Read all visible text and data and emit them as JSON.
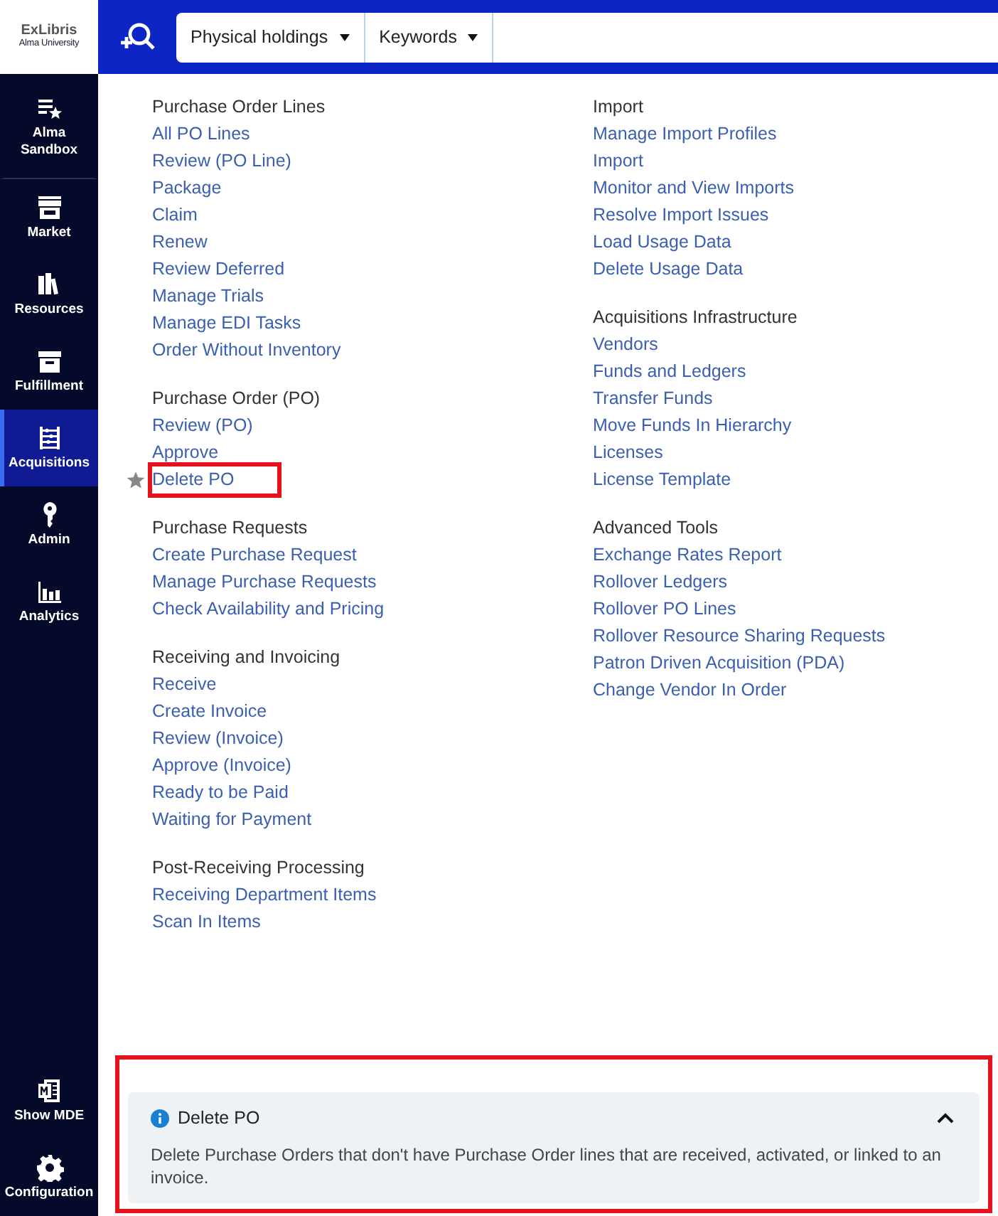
{
  "logo": {
    "brand": "ExLibris",
    "institution": "Alma University"
  },
  "search": {
    "scope": "Physical holdings",
    "field": "Keywords"
  },
  "sidebar": {
    "items": [
      {
        "label": "Alma Sandbox",
        "kind": "favorites",
        "selected": false
      },
      {
        "label": "Market",
        "kind": "market",
        "selected": false
      },
      {
        "label": "Resources",
        "kind": "resources",
        "selected": false
      },
      {
        "label": "Fulfillment",
        "kind": "fulfillment",
        "selected": false
      },
      {
        "label": "Acquisitions",
        "kind": "acquisitions",
        "selected": true
      },
      {
        "label": "Admin",
        "kind": "admin",
        "selected": false
      },
      {
        "label": "Analytics",
        "kind": "analytics",
        "selected": false
      }
    ],
    "bottom_items": [
      {
        "label": "Show MDE",
        "kind": "editor",
        "selected": false
      },
      {
        "label": "Configuration",
        "kind": "configuration",
        "selected": false
      }
    ]
  },
  "menu": {
    "columns": [
      {
        "sections": [
          {
            "heading": "Purchase Order Lines",
            "links": [
              {
                "label": "All PO Lines",
                "highlighted": false
              },
              {
                "label": "Review (PO Line)",
                "highlighted": false
              },
              {
                "label": "Package",
                "highlighted": false
              },
              {
                "label": "Claim",
                "highlighted": false
              },
              {
                "label": "Renew",
                "highlighted": false
              },
              {
                "label": "Review Deferred",
                "highlighted": false
              },
              {
                "label": "Manage Trials",
                "highlighted": false
              },
              {
                "label": "Manage EDI Tasks",
                "highlighted": false
              },
              {
                "label": "Order Without Inventory",
                "highlighted": false
              }
            ]
          },
          {
            "heading": "Purchase Order (PO)",
            "links": [
              {
                "label": "Review (PO)",
                "highlighted": false
              },
              {
                "label": "Approve",
                "highlighted": false
              },
              {
                "label": "Delete PO",
                "highlighted": true
              }
            ]
          },
          {
            "heading": "Purchase Requests",
            "links": [
              {
                "label": "Create Purchase Request",
                "highlighted": false
              },
              {
                "label": "Manage Purchase Requests",
                "highlighted": false
              },
              {
                "label": "Check Availability and Pricing",
                "highlighted": false
              }
            ]
          },
          {
            "heading": "Receiving and Invoicing",
            "links": [
              {
                "label": "Receive",
                "highlighted": false
              },
              {
                "label": "Create Invoice",
                "highlighted": false
              },
              {
                "label": "Review (Invoice)",
                "highlighted": false
              },
              {
                "label": "Approve (Invoice)",
                "highlighted": false
              },
              {
                "label": "Ready to be Paid",
                "highlighted": false
              },
              {
                "label": "Waiting for Payment",
                "highlighted": false
              }
            ]
          },
          {
            "heading": "Post-Receiving Processing",
            "links": [
              {
                "label": "Receiving Department Items",
                "highlighted": false
              },
              {
                "label": "Scan In Items",
                "highlighted": false
              }
            ]
          }
        ]
      },
      {
        "sections": [
          {
            "heading": "Import",
            "links": [
              {
                "label": "Manage Import Profiles",
                "highlighted": false
              },
              {
                "label": "Import",
                "highlighted": false
              },
              {
                "label": "Monitor and View Imports",
                "highlighted": false
              },
              {
                "label": "Resolve Import Issues",
                "highlighted": false
              },
              {
                "label": "Load Usage Data",
                "highlighted": false
              },
              {
                "label": "Delete Usage Data",
                "highlighted": false
              }
            ]
          },
          {
            "heading": "Acquisitions Infrastructure",
            "links": [
              {
                "label": "Vendors",
                "highlighted": false
              },
              {
                "label": "Funds and Ledgers",
                "highlighted": false
              },
              {
                "label": "Transfer Funds",
                "highlighted": false
              },
              {
                "label": "Move Funds In Hierarchy",
                "highlighted": false
              },
              {
                "label": "Licenses",
                "highlighted": false
              },
              {
                "label": "License Template",
                "highlighted": false
              }
            ]
          },
          {
            "heading": "Advanced Tools",
            "links": [
              {
                "label": "Exchange Rates Report",
                "highlighted": false
              },
              {
                "label": "Rollover Ledgers",
                "highlighted": false
              },
              {
                "label": "Rollover PO Lines",
                "highlighted": false
              },
              {
                "label": "Rollover Resource Sharing Requests",
                "highlighted": false
              },
              {
                "label": "Patron Driven Acquisition (PDA)",
                "highlighted": false
              },
              {
                "label": "Change Vendor In Order",
                "highlighted": false
              }
            ]
          }
        ]
      }
    ]
  },
  "info_panel": {
    "title": "Delete PO",
    "expanded": true,
    "highlighted": true,
    "description": "Delete Purchase Orders that don't have Purchase Order lines that are received, activated, or linked to an invoice."
  }
}
